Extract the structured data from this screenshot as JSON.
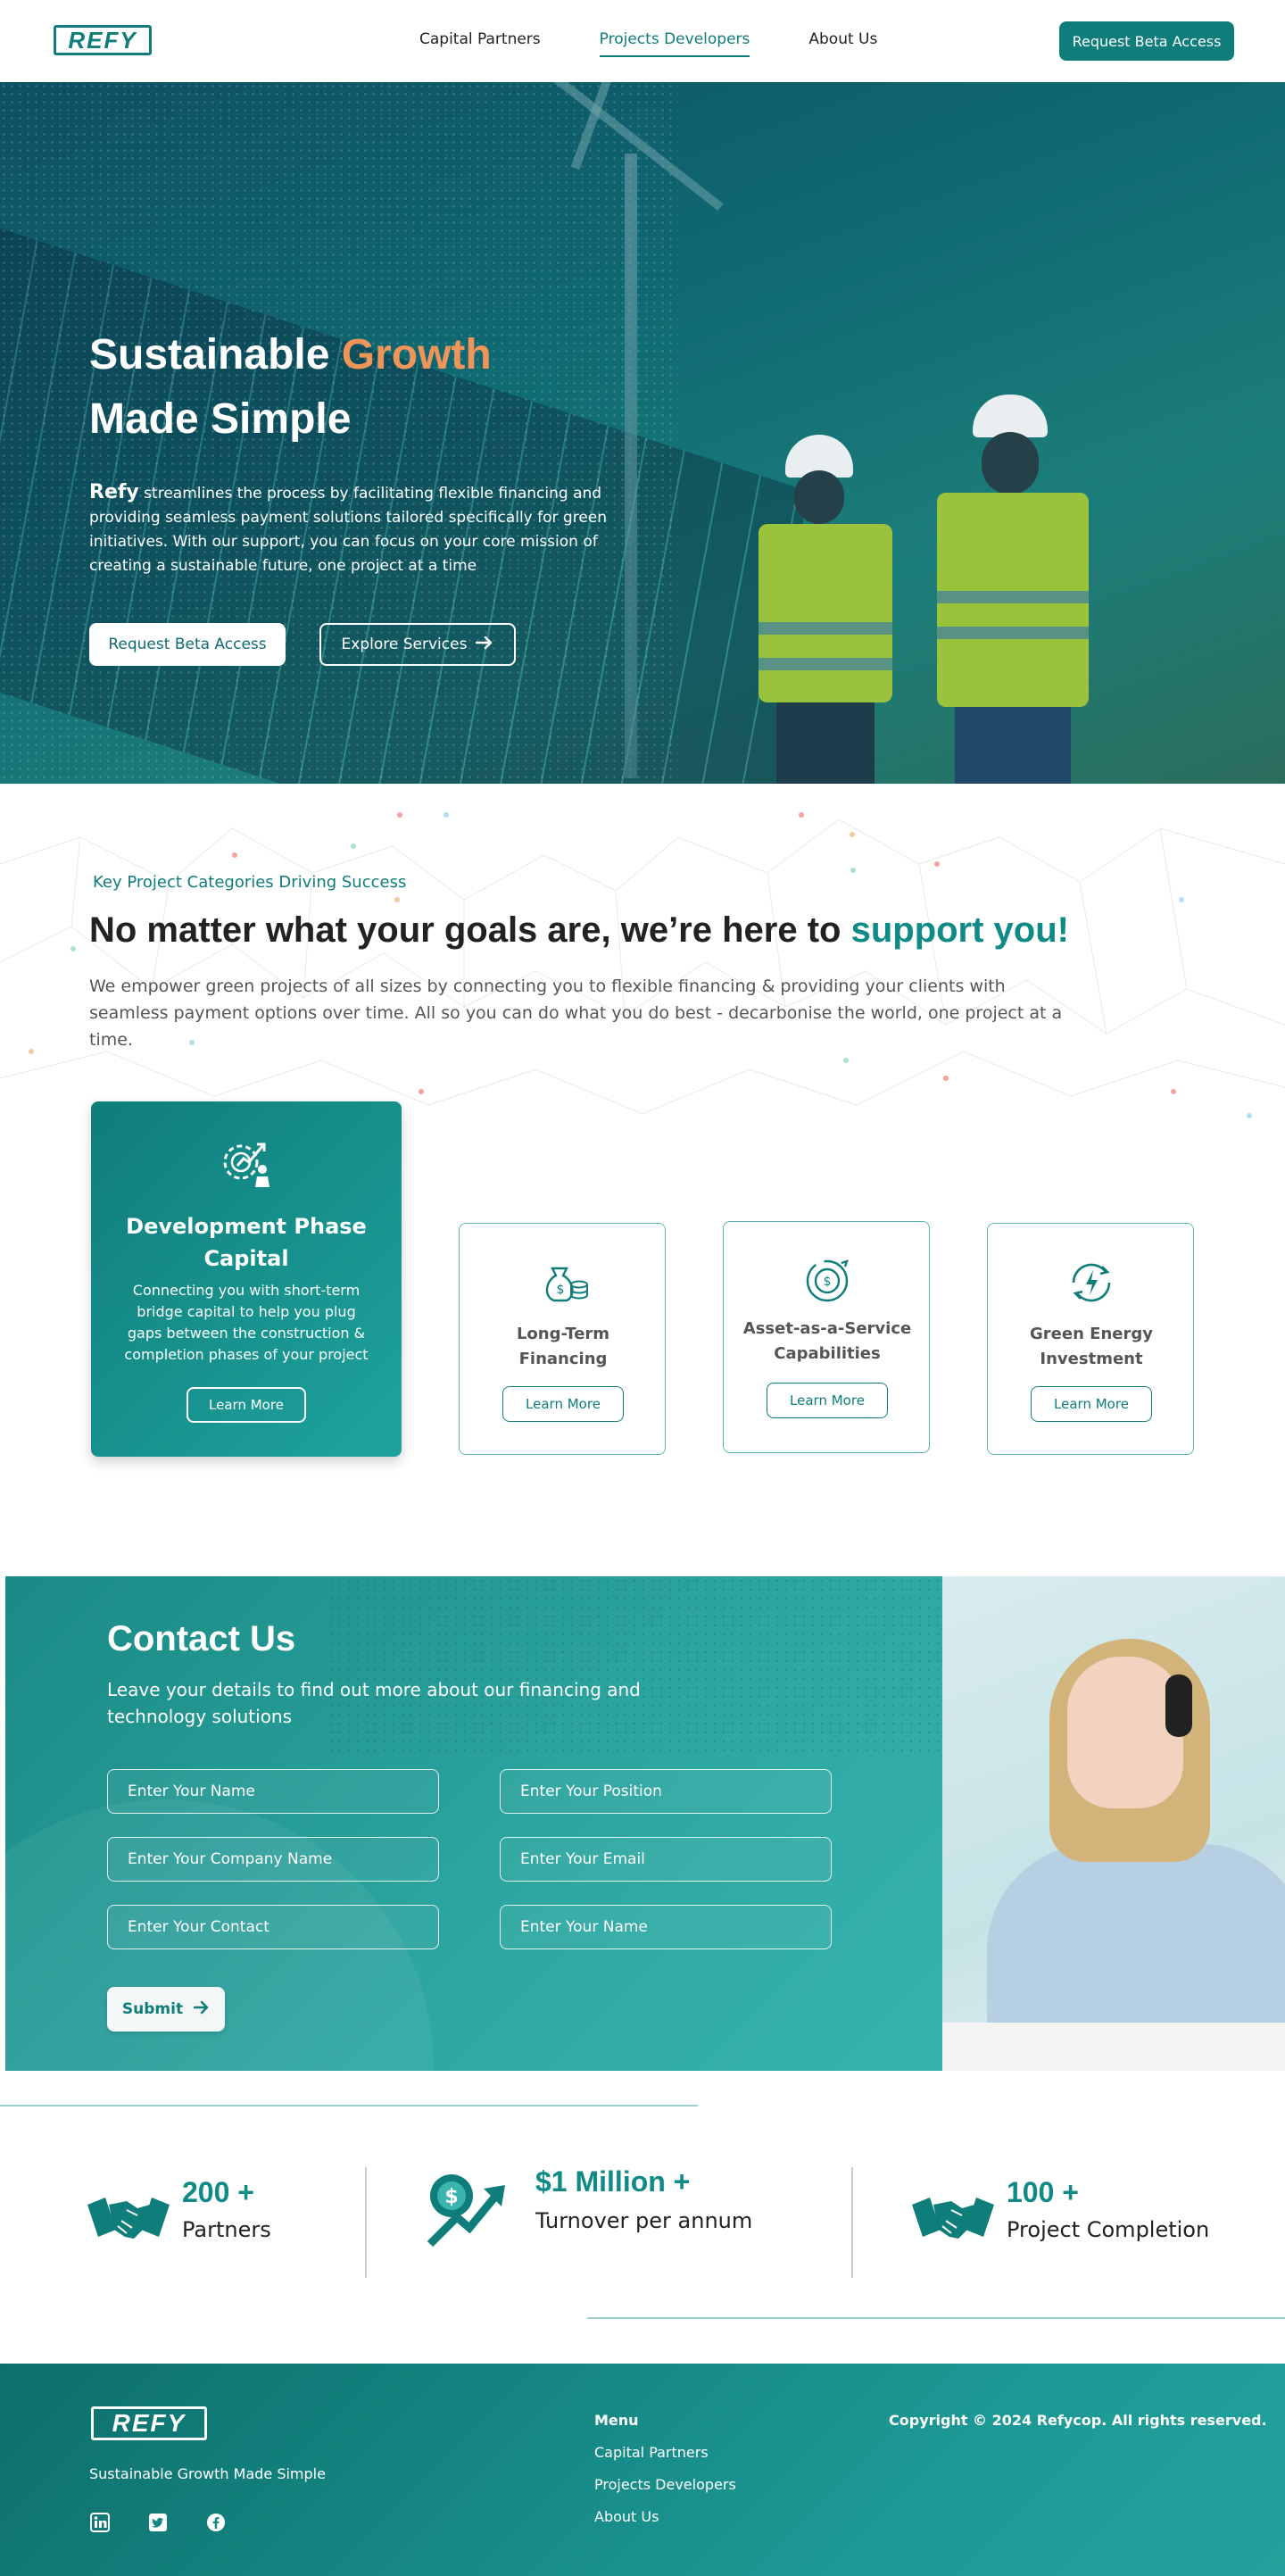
{
  "brand": {
    "logo_text": "REFY",
    "accent": "#0f7d7a",
    "highlight": "#f0955a"
  },
  "nav": {
    "links": [
      "Capital Partners",
      "Projects Developers",
      "About Us"
    ],
    "active": "Projects Developers",
    "cta": "Request Beta Access"
  },
  "hero": {
    "title_part1": "Sustainable ",
    "title_accent": "Growth",
    "title_part2": "Made Simple",
    "brand_word": "Refy",
    "description": " streamlines the process by facilitating flexible financing and providing seamless payment solutions tailored specifically for green initiatives. With our support, you can focus on your core mission of creating a sustainable future, one project at a time",
    "primary_button": "Request Beta Access",
    "secondary_button": "Explore Services"
  },
  "categories": {
    "eyebrow": "Key Project Categories Driving Success",
    "title_main": "No matter what your goals are, we’re here to ",
    "title_accent": "support you!",
    "description": "We empower green projects of all sizes by connecting you to flexible financing & providing your clients with seamless payment options over time. All so you can do what you do best - decarbonise the world, one project at a time.",
    "featured": {
      "icon": "gear-growth-icon",
      "title": "Development Phase Capital",
      "description": "Connecting you with short-term bridge capital to help you plug gaps between the construction & completion phases of your project",
      "button": "Learn More"
    },
    "cards": [
      {
        "icon": "money-bag-coins-icon",
        "title": "Long-Term Financing",
        "button": "Learn More"
      },
      {
        "icon": "dollar-cycle-icon",
        "title": "Asset-as-a-Service Capabilities",
        "button": "Learn More"
      },
      {
        "icon": "energy-cycle-icon",
        "title": "Green Energy Investment",
        "button": "Learn More"
      }
    ]
  },
  "contact": {
    "title": "Contact Us",
    "description": "Leave your details to find out more about our financing and technology solutions",
    "fields": [
      {
        "placeholder": "Enter Your Name",
        "value": ""
      },
      {
        "placeholder": "Enter Your Position",
        "value": ""
      },
      {
        "placeholder": "Enter Your Company Name",
        "value": ""
      },
      {
        "placeholder": "Enter Your Email",
        "value": ""
      },
      {
        "placeholder": "Enter Your Contact",
        "value": ""
      },
      {
        "placeholder": "Enter Your Name",
        "value": ""
      }
    ],
    "submit": "Submit"
  },
  "stats": [
    {
      "icon": "handshake-icon",
      "value": "200 +",
      "label": "Partners"
    },
    {
      "icon": "dollar-growth-icon",
      "value": "$1 Million +",
      "label": "Turnover per annum"
    },
    {
      "icon": "handshake-icon",
      "value": "100 +",
      "label": "Project Completion"
    }
  ],
  "footer": {
    "logo_text": "REFY",
    "tagline": "Sustainable Growth Made Simple",
    "social": [
      "linkedin-icon",
      "twitter-icon",
      "facebook-icon"
    ],
    "menu_title": "Menu",
    "menu": [
      "Capital Partners",
      "Projects Developers",
      "About Us"
    ],
    "copyright": "Copyright © 2024 Refycop. All rights reserved."
  }
}
